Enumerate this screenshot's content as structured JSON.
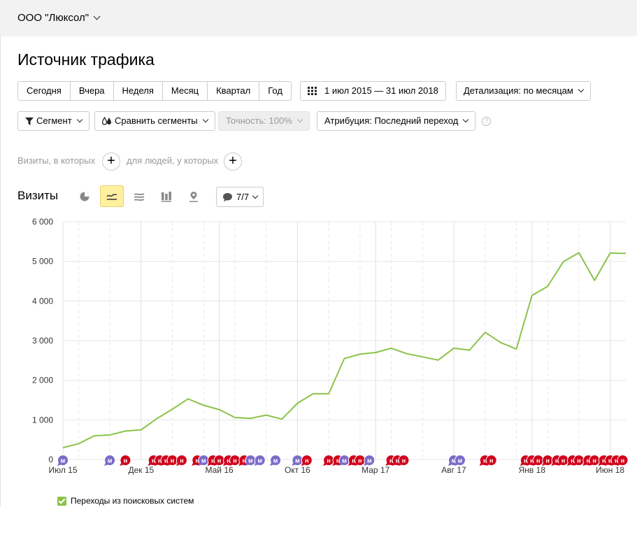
{
  "header": {
    "org_name": "ООО \"Люксол\""
  },
  "page": {
    "title": "Источник трафика"
  },
  "period_buttons": [
    "Сегодня",
    "Вчера",
    "Неделя",
    "Месяц",
    "Квартал",
    "Год"
  ],
  "date_range": "1 июл 2015 — 31 июл 2018",
  "detail": "Детализация: по месяцам",
  "segment": "Сегмент",
  "compare": "Сравнить сегменты",
  "accuracy": "Точность: 100%",
  "attribution": "Атрибуция: Последний переход",
  "help": "?",
  "filters": {
    "visits_where": "Визиты, в которых",
    "people_where": "для людей, у которых"
  },
  "chart_section": {
    "label": "Визиты",
    "counter": "7/7"
  },
  "legend": {
    "label": "Переходы из поисковых систем"
  },
  "colors": {
    "line": "#8bc34a",
    "marker_m": "#7c6bc8",
    "marker_n": "#d0021b",
    "active_tool": "#fff0a0"
  },
  "icons": [
    "pie-icon",
    "line-chart-icon",
    "area-icon",
    "bar-icon",
    "map-icon",
    "comment-icon"
  ],
  "chart_data": {
    "type": "line",
    "title": "",
    "xlabel": "",
    "ylabel": "",
    "ylim": [
      0,
      6000
    ],
    "yticks": [
      0,
      1000,
      2000,
      3000,
      4000,
      5000,
      6000
    ],
    "ytick_labels": [
      "0",
      "1 000",
      "2 000",
      "3 000",
      "4 000",
      "5 000",
      "6 000"
    ],
    "xtick_labels": [
      "Июл 15",
      "Дек 15",
      "Май 16",
      "Окт 16",
      "Мар 17",
      "Авг 17",
      "Янв 18",
      "Июн 18"
    ],
    "x": [
      "2015-07",
      "2015-08",
      "2015-09",
      "2015-10",
      "2015-11",
      "2015-12",
      "2016-01",
      "2016-02",
      "2016-03",
      "2016-04",
      "2016-05",
      "2016-06",
      "2016-07",
      "2016-08",
      "2016-09",
      "2016-10",
      "2016-11",
      "2016-12",
      "2017-01",
      "2017-02",
      "2017-03",
      "2017-04",
      "2017-05",
      "2017-06",
      "2017-07",
      "2017-08",
      "2017-09",
      "2017-10",
      "2017-11",
      "2017-12",
      "2018-01",
      "2018-02",
      "2018-03",
      "2018-04",
      "2018-05",
      "2018-06",
      "2018-07"
    ],
    "series": [
      {
        "name": "Переходы из поисковых систем",
        "values": [
          300,
          400,
          600,
          620,
          720,
          750,
          1030,
          1270,
          1530,
          1370,
          1260,
          1060,
          1040,
          1120,
          1020,
          1420,
          1660,
          1660,
          2550,
          2660,
          2700,
          2810,
          2670,
          2590,
          2510,
          2810,
          2760,
          3210,
          2950,
          2790,
          4140,
          4370,
          4990,
          5220,
          4520,
          5210,
          5200
        ]
      }
    ],
    "markers": [
      {
        "month": 0,
        "label": "м",
        "type": "m"
      },
      {
        "month": 3,
        "label": "м",
        "type": "m"
      },
      {
        "month": 4,
        "label": "н",
        "type": "n"
      },
      {
        "month": 5.8,
        "label": "н",
        "type": "n"
      },
      {
        "month": 6.2,
        "label": "н",
        "type": "n"
      },
      {
        "month": 6.6,
        "label": "н",
        "type": "n"
      },
      {
        "month": 7.0,
        "label": "н",
        "type": "n"
      },
      {
        "month": 7.6,
        "label": "н",
        "type": "n"
      },
      {
        "month": 8.6,
        "label": "н",
        "type": "n"
      },
      {
        "month": 9.0,
        "label": "м",
        "type": "m"
      },
      {
        "month": 9.6,
        "label": "н",
        "type": "n"
      },
      {
        "month": 10.0,
        "label": "н",
        "type": "n"
      },
      {
        "month": 10.6,
        "label": "н",
        "type": "n"
      },
      {
        "month": 11.0,
        "label": "н",
        "type": "n"
      },
      {
        "month": 11.6,
        "label": "н",
        "type": "n"
      },
      {
        "month": 12.0,
        "label": "м",
        "type": "m"
      },
      {
        "month": 12.6,
        "label": "м",
        "type": "m"
      },
      {
        "month": 13.6,
        "label": "м",
        "type": "m"
      },
      {
        "month": 15.0,
        "label": "м",
        "type": "m"
      },
      {
        "month": 15.6,
        "label": "н",
        "type": "n"
      },
      {
        "month": 17.0,
        "label": "н",
        "type": "n"
      },
      {
        "month": 17.6,
        "label": "н",
        "type": "n"
      },
      {
        "month": 18.0,
        "label": "м",
        "type": "m"
      },
      {
        "month": 18.6,
        "label": "н",
        "type": "n"
      },
      {
        "month": 19.0,
        "label": "н",
        "type": "n"
      },
      {
        "month": 19.6,
        "label": "м",
        "type": "m"
      },
      {
        "month": 21.0,
        "label": "н",
        "type": "n"
      },
      {
        "month": 21.4,
        "label": "н",
        "type": "n"
      },
      {
        "month": 21.8,
        "label": "н",
        "type": "n"
      },
      {
        "month": 25.0,
        "label": "м",
        "type": "m"
      },
      {
        "month": 25.4,
        "label": "м",
        "type": "m"
      },
      {
        "month": 27.0,
        "label": "н",
        "type": "n"
      },
      {
        "month": 27.4,
        "label": "н",
        "type": "n"
      },
      {
        "month": 29.6,
        "label": "н",
        "type": "n"
      },
      {
        "month": 30.0,
        "label": "н",
        "type": "n"
      },
      {
        "month": 30.4,
        "label": "н",
        "type": "n"
      },
      {
        "month": 31.0,
        "label": "н",
        "type": "n"
      },
      {
        "month": 31.6,
        "label": "н",
        "type": "n"
      },
      {
        "month": 32.0,
        "label": "н",
        "type": "n"
      },
      {
        "month": 32.6,
        "label": "н",
        "type": "n"
      },
      {
        "month": 33.0,
        "label": "н",
        "type": "n"
      },
      {
        "month": 33.6,
        "label": "н",
        "type": "n"
      },
      {
        "month": 34.0,
        "label": "н",
        "type": "n"
      },
      {
        "month": 34.6,
        "label": "н",
        "type": "n"
      },
      {
        "month": 35.0,
        "label": "н",
        "type": "n"
      },
      {
        "month": 35.4,
        "label": "н",
        "type": "n"
      },
      {
        "month": 35.8,
        "label": "н",
        "type": "n"
      }
    ],
    "grid": true,
    "legend_position": "bottom-left"
  }
}
